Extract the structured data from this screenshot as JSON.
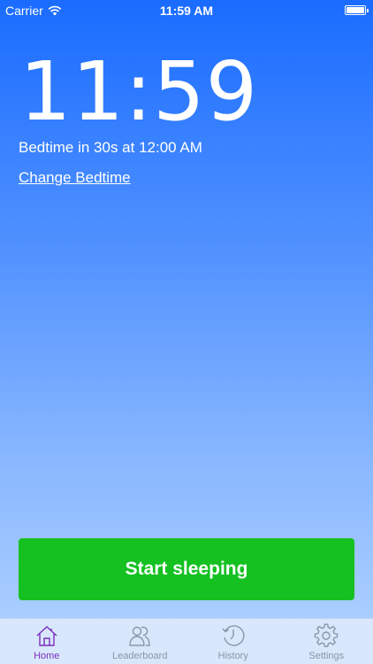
{
  "status_bar": {
    "carrier": "Carrier",
    "time": "11:59 AM"
  },
  "main": {
    "clock": "11:59",
    "bedtime_text": "Bedtime in 30s at 12:00 AM",
    "change_bedtime_link": "Change Bedtime",
    "start_button": "Start sleeping"
  },
  "tabs": [
    {
      "label": "Home",
      "icon": "home-icon",
      "active": true
    },
    {
      "label": "Leaderboard",
      "icon": "users-icon",
      "active": false
    },
    {
      "label": "History",
      "icon": "clock-history-icon",
      "active": false
    },
    {
      "label": "Settings",
      "icon": "gear-icon",
      "active": false
    }
  ],
  "colors": {
    "background_top": "#1a6cff",
    "background_bottom": "#b3d4ff",
    "start_button": "#14c121",
    "tab_active": "#7b2fbe",
    "tab_inactive": "#8a96a8",
    "tab_bar": "#d8e7fb"
  }
}
